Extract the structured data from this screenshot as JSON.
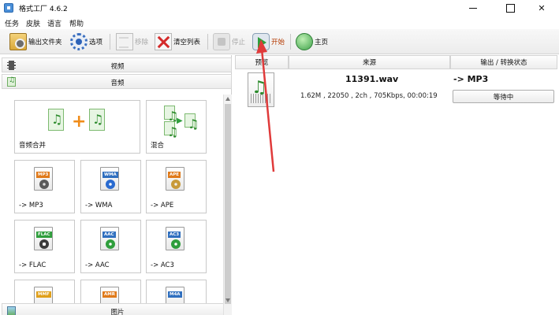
{
  "window": {
    "title": "格式工厂 4.6.2",
    "controls": {
      "minimize": "—",
      "maximize": "□",
      "close": "✕"
    }
  },
  "menu": [
    "任务",
    "皮肤",
    "语言",
    "帮助"
  ],
  "toolbar": {
    "add_file": "输出文件夹",
    "options": "选项",
    "remove": "移除",
    "clear_list": "清空列表",
    "stop": "停止",
    "start": "开始",
    "home": "主页"
  },
  "left": {
    "categories": {
      "video": "视频",
      "audio": "音频",
      "picture": "图片"
    },
    "tiles": [
      {
        "label": "音频合并",
        "badge": ""
      },
      {
        "label": "混合",
        "badge": ""
      },
      {
        "label": "-> MP3",
        "badge": "MP3",
        "color": "#e07a1a",
        "disc": "#5a5a5a"
      },
      {
        "label": "-> WMA",
        "badge": "WMA",
        "color": "#2f6fbf",
        "disc": "#2a6bd0"
      },
      {
        "label": "-> APE",
        "badge": "APE",
        "color": "#e07a1a",
        "disc": "#c89a3a"
      },
      {
        "label": "-> FLAC",
        "badge": "FLAC",
        "color": "#2f9e3c",
        "disc": "#3a3a3a"
      },
      {
        "label": "-> AAC",
        "badge": "AAC",
        "color": "#2f6fbf",
        "disc": "#2f9e3c"
      },
      {
        "label": "-> AC3",
        "badge": "AC3",
        "color": "#2f6fbf",
        "disc": "#2f9e3c"
      },
      {
        "label": "",
        "badge": "MMF",
        "color": "#e0a01a",
        "disc": "#999"
      },
      {
        "label": "",
        "badge": "AMR",
        "color": "#e07a1a",
        "disc": "#999"
      },
      {
        "label": "",
        "badge": "M4A",
        "color": "#2f6fbf",
        "disc": "#999"
      }
    ]
  },
  "right": {
    "columns": [
      "预览",
      "来源",
      "输出 / 转换状态"
    ],
    "rows": [
      {
        "filename": "11391.wav",
        "info": "1.62M , 22050 , 2ch , 705Kbps, 00:00:19",
        "target": "-> MP3",
        "status": "等待中"
      }
    ]
  },
  "annotation_color": "#e03a3a"
}
